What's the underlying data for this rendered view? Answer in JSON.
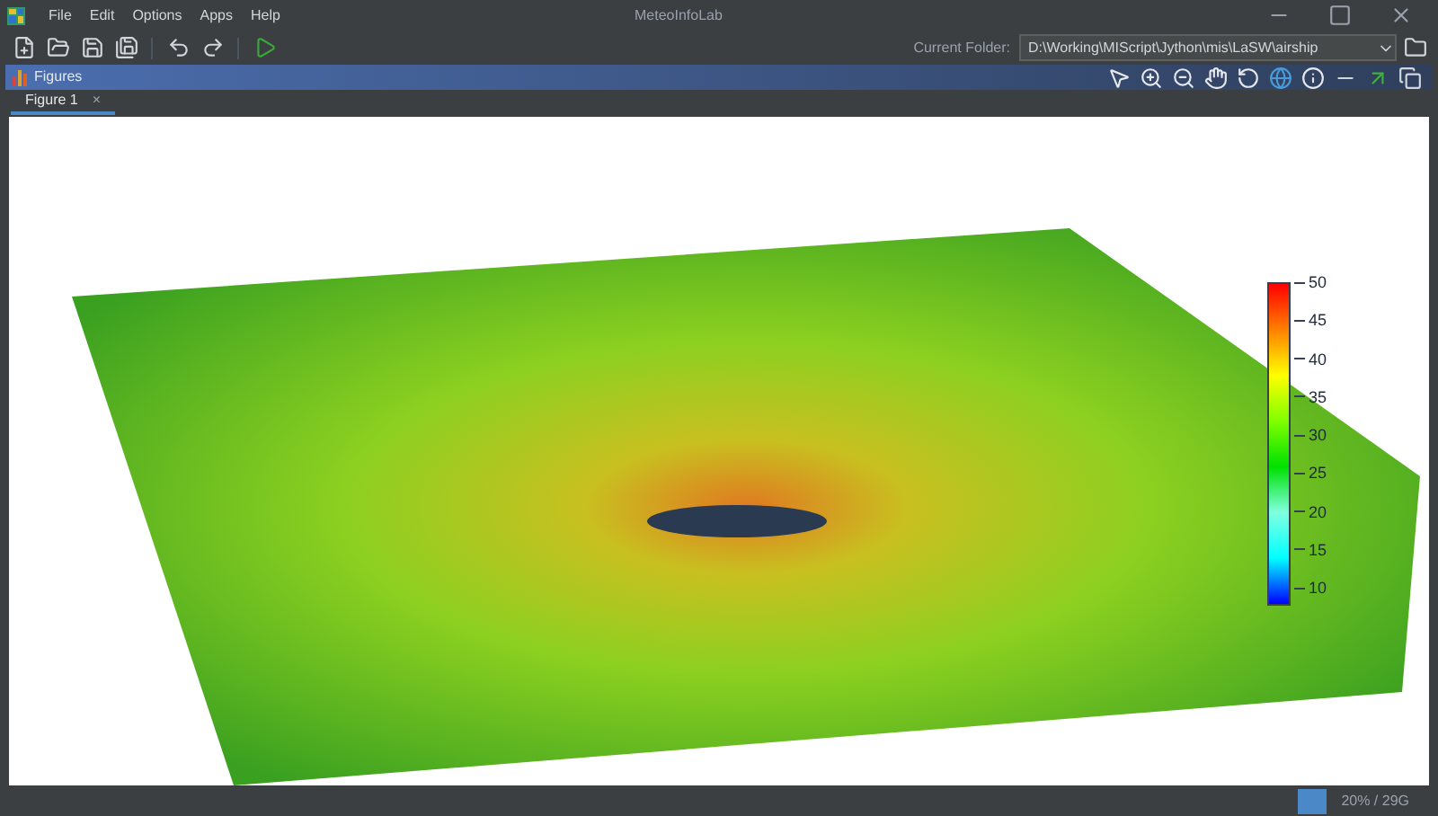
{
  "window": {
    "title": "MeteoInfoLab"
  },
  "menu": [
    "File",
    "Edit",
    "Options",
    "Apps",
    "Help"
  ],
  "current_folder": {
    "label": "Current Folder:",
    "value": "D:\\Working\\MIScript\\Jython\\mis\\LaSW\\airship"
  },
  "figures_panel": {
    "title": "Figures"
  },
  "tabs": [
    {
      "label": "Figure 1",
      "close": "×",
      "selected": true
    }
  ],
  "colorbar": {
    "ticks": [
      "50",
      "45",
      "40",
      "35",
      "30",
      "25",
      "20",
      "15",
      "10"
    ]
  },
  "status_bar": {
    "memory": "20% / 29G"
  }
}
